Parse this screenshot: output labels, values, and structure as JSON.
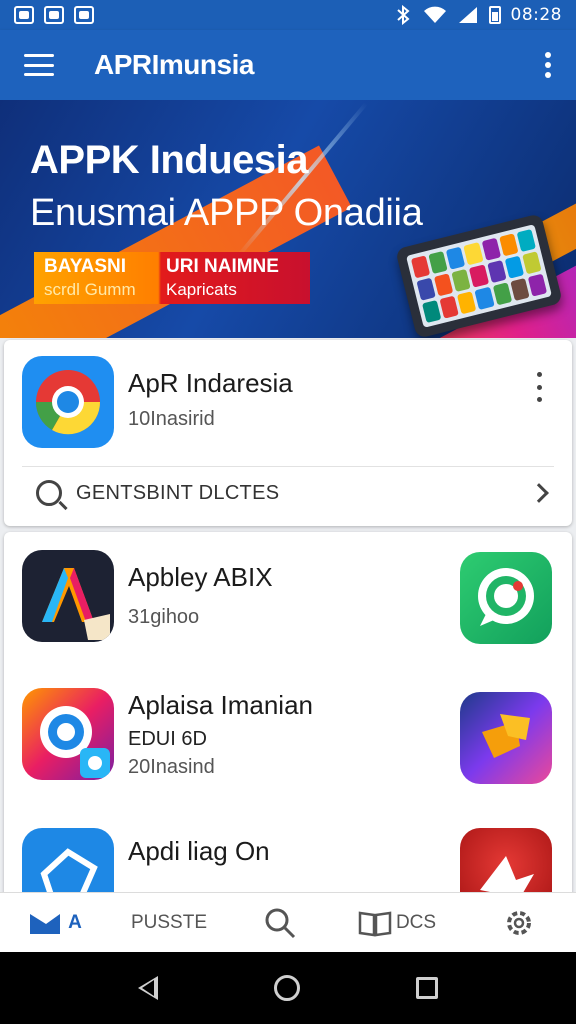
{
  "status_bar": {
    "time": "08:28"
  },
  "app_bar": {
    "title": "APRImunsia"
  },
  "banner": {
    "line1": "APPK Induesia",
    "line2": "Enusmai APPP Onadiia",
    "tag_top_left": "BAYASNI",
    "tag_top_right": "URI NAIMNE",
    "tag_bottom_left": "scrdl Gumm",
    "tag_bottom_right": "Kapricats"
  },
  "featured": {
    "name": "ApR Indaresia",
    "meta": "10Inasirid",
    "search_label": "GENTSBINT DLCTES"
  },
  "apps": [
    {
      "name": "Apbley ABIX",
      "meta1": "31gihoo",
      "meta2": ""
    },
    {
      "name": "Aplaisa Imanian",
      "meta1": "EDUI 6D",
      "meta2": "20Inasind"
    },
    {
      "name": "Apdi liag On",
      "meta1": "",
      "meta2": ""
    }
  ],
  "bottom_nav": {
    "home_label": "A",
    "posts_label": "PUSSTE",
    "docs_label": "DCS"
  },
  "colors": {
    "primary": "#1e62bd",
    "status_bar": "#1c5fb6",
    "banner_orange": "#ff8a00",
    "banner_red": "#e21b1b"
  }
}
